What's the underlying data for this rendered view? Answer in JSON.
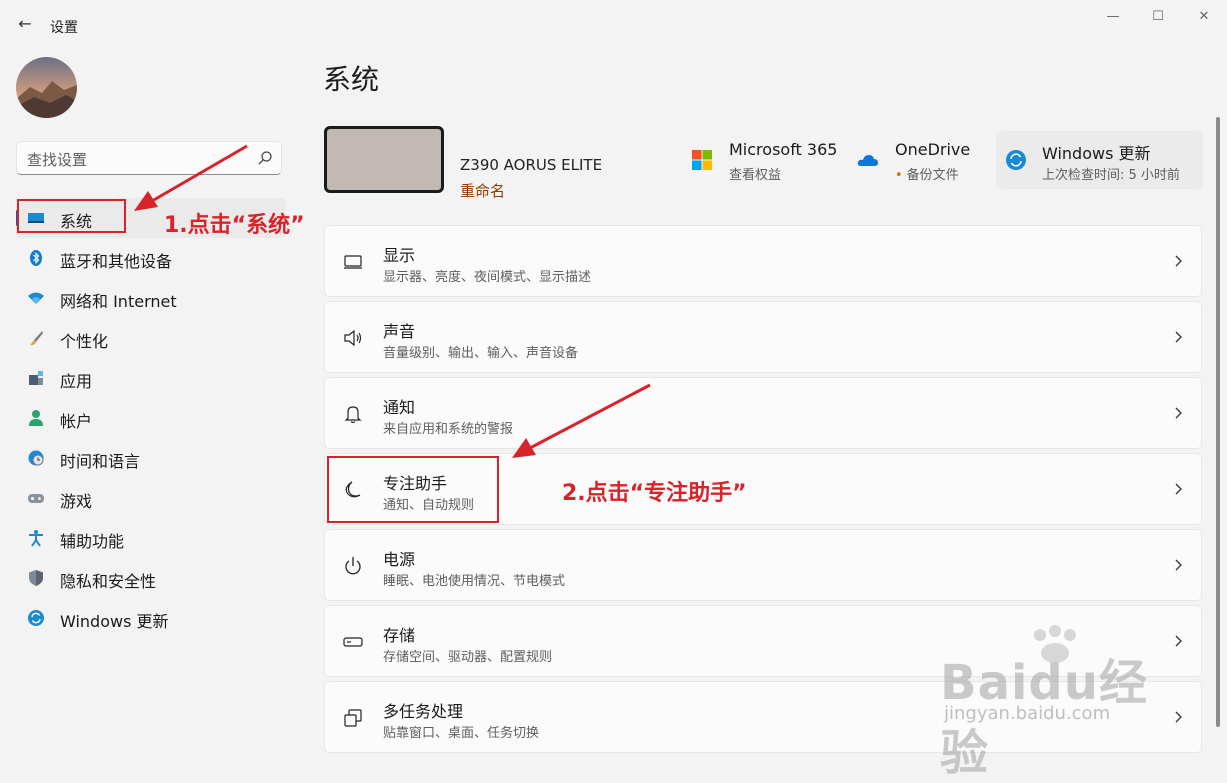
{
  "window": {
    "back_glyph": "←",
    "title": "设置",
    "minimize_glyph": "—",
    "maximize_glyph": "☐",
    "close_glyph": "✕"
  },
  "sidebar": {
    "search_placeholder": "查找设置",
    "items": [
      {
        "label": "系统",
        "icon": "system-display-icon",
        "selected": true
      },
      {
        "label": "蓝牙和其他设备",
        "icon": "bluetooth-icon"
      },
      {
        "label": "网络和 Internet",
        "icon": "wifi-icon"
      },
      {
        "label": "个性化",
        "icon": "brush-icon"
      },
      {
        "label": "应用",
        "icon": "apps-icon"
      },
      {
        "label": "帐户",
        "icon": "account-icon"
      },
      {
        "label": "时间和语言",
        "icon": "clock-globe-icon"
      },
      {
        "label": "游戏",
        "icon": "gamepad-icon"
      },
      {
        "label": "辅助功能",
        "icon": "accessibility-icon"
      },
      {
        "label": "隐私和安全性",
        "icon": "shield-icon"
      },
      {
        "label": "Windows 更新",
        "icon": "windows-update-icon"
      }
    ]
  },
  "main": {
    "title": "系统",
    "device": {
      "name": "Z390 AORUS ELITE",
      "rename": "重命名"
    },
    "quick_links": [
      {
        "title": "Microsoft 365",
        "sub": "查看权益",
        "icon": "microsoft-logo-icon"
      },
      {
        "title": "OneDrive",
        "sub": "备份文件",
        "sub_dot": "•",
        "icon": "onedrive-cloud-icon"
      },
      {
        "title": "Windows 更新",
        "sub": "上次检查时间: 5 小时前",
        "icon": "windows-update-icon"
      }
    ],
    "cards": [
      {
        "title": "显示",
        "sub": "显示器、亮度、夜间模式、显示描述",
        "icon": "display-icon"
      },
      {
        "title": "声音",
        "sub": "音量级别、输出、输入、声音设备",
        "icon": "speaker-icon"
      },
      {
        "title": "通知",
        "sub": "来自应用和系统的警报",
        "icon": "bell-icon"
      },
      {
        "title": "专注助手",
        "sub": "通知、自动规则",
        "icon": "moon-icon"
      },
      {
        "title": "电源",
        "sub": "睡眠、电池使用情况、节电模式",
        "icon": "power-icon"
      },
      {
        "title": "存储",
        "sub": "存储空间、驱动器、配置规则",
        "icon": "storage-drive-icon"
      },
      {
        "title": "多任务处理",
        "sub": "贴靠窗口、桌面、任务切换",
        "icon": "multitask-icon"
      }
    ]
  },
  "annotations": {
    "step1": "1.点击“系统”",
    "step2": "2.点击“专注助手”",
    "color": "#d8232a"
  },
  "watermark": {
    "main": "Baidu经验",
    "sub": "jingyan.baidu.com"
  },
  "colors": {
    "accent": "#005fb8",
    "rename_link": "#9b3500",
    "window_bg": "#f3f3f3",
    "card_bg": "#fbfbfb"
  }
}
